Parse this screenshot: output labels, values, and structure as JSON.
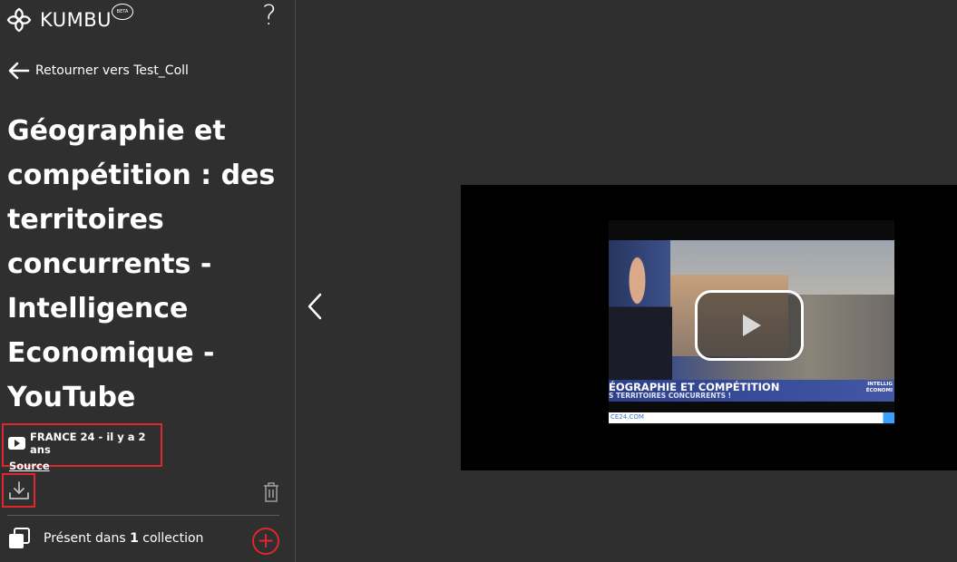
{
  "header": {
    "logo_text": "KUMBU",
    "beta_label": "BETA",
    "help_label": "?"
  },
  "navigation": {
    "back_label": "Retourner vers Test_Coll"
  },
  "item": {
    "title": "Géographie et compétition : des territoires concurrents - Intelligence Economique - YouTube",
    "source_meta": "FRANCE 24 - il y a 2 ans",
    "source_link_label": "Source"
  },
  "collections": {
    "prefix": "Présent dans ",
    "count": "1",
    "suffix": " collection",
    "add_label": "+"
  },
  "video": {
    "banner_main": "ÉOGRAPHIE ET COMPÉTITION",
    "banner_sub": "S TERRITOIRES CONCURRENTS !",
    "banner_right_1": "INTELLIG",
    "banner_right_2": "ÉCONOMI",
    "ticker": "CE24.COM"
  },
  "colors": {
    "background": "#2f2f2f",
    "accent_red": "#e0262d",
    "text": "#ffffff"
  },
  "icons": {
    "logo": "kumbu-flower-icon",
    "back": "arrow-left-icon",
    "source": "youtube-icon",
    "download": "download-icon",
    "trash": "trash-icon",
    "collection": "stacked-squares-icon",
    "add": "plus-circle-icon",
    "collapse": "chevron-left-icon",
    "play": "play-icon"
  }
}
